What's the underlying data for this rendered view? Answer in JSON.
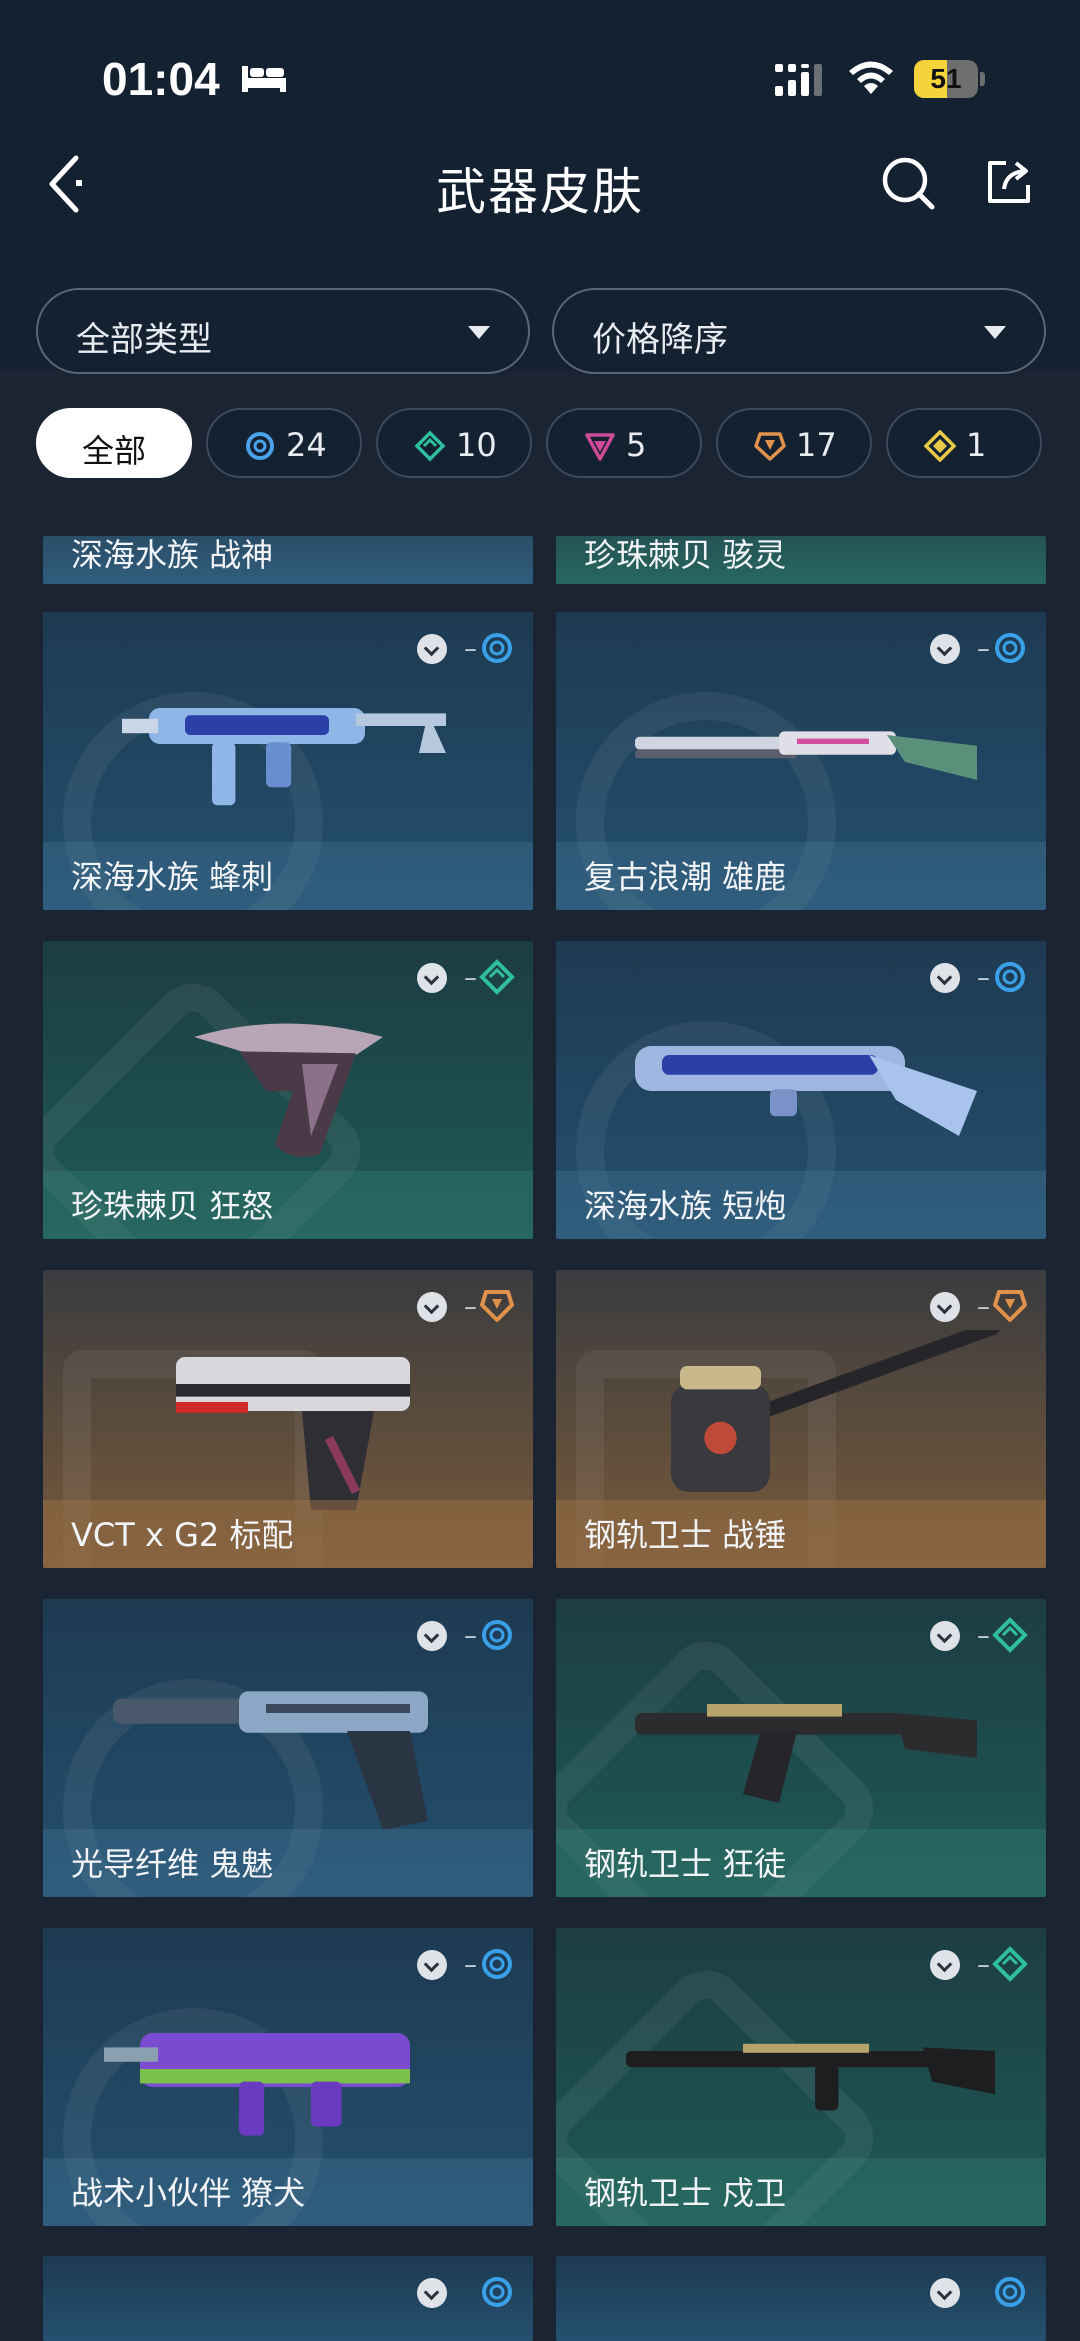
{
  "status_bar": {
    "time": "01:04",
    "battery": "51",
    "battery_level": 0.51
  },
  "header": {
    "title": "武器皮肤"
  },
  "filters": {
    "type_label": "全部类型",
    "sort_label": "价格降序"
  },
  "tiers": [
    {
      "label": "全部",
      "count": ""
    },
    {
      "icon": "select-tier-icon",
      "color": "#4aa3e8",
      "count": "24"
    },
    {
      "icon": "deluxe-tier-icon",
      "color": "#2fbf9f",
      "count": "10"
    },
    {
      "icon": "premium-tier-icon",
      "color": "#d04a9a",
      "count": "5"
    },
    {
      "icon": "exclusive-tier-icon",
      "color": "#e0914a",
      "count": "17"
    },
    {
      "icon": "ultra-tier-icon",
      "color": "#e9c84a",
      "count": "1"
    }
  ],
  "top_cards": [
    {
      "name": "深海水族 战神",
      "tier": "blue"
    },
    {
      "name": "珍珠棘贝 骇灵",
      "tier": "teal"
    }
  ],
  "cards": [
    {
      "name": "深海水族 蜂刺",
      "tier": "blue",
      "dash": "–"
    },
    {
      "name": "复古浪潮 雄鹿",
      "tier": "blue",
      "dash": "–"
    },
    {
      "name": "珍珠棘贝 狂怒",
      "tier": "teal",
      "dash": "–"
    },
    {
      "name": "深海水族 短炮",
      "tier": "blue",
      "dash": "–"
    },
    {
      "name": "VCT x G2 标配",
      "tier": "orange",
      "dash": "–"
    },
    {
      "name": "钢轨卫士 战锤",
      "tier": "orange",
      "dash": "–"
    },
    {
      "name": "光导纤维 鬼魅",
      "tier": "blue",
      "dash": "–"
    },
    {
      "name": "钢轨卫士 狂徒",
      "tier": "teal",
      "dash": "–"
    },
    {
      "name": "战术小伙伴 獠犬",
      "tier": "blue",
      "dash": "–"
    },
    {
      "name": "钢轨卫士 戍卫",
      "tier": "teal",
      "dash": "–"
    }
  ],
  "colors": {
    "blue": "#3aa0e8",
    "teal": "#2fbf9f",
    "orange": "#e0914a"
  }
}
